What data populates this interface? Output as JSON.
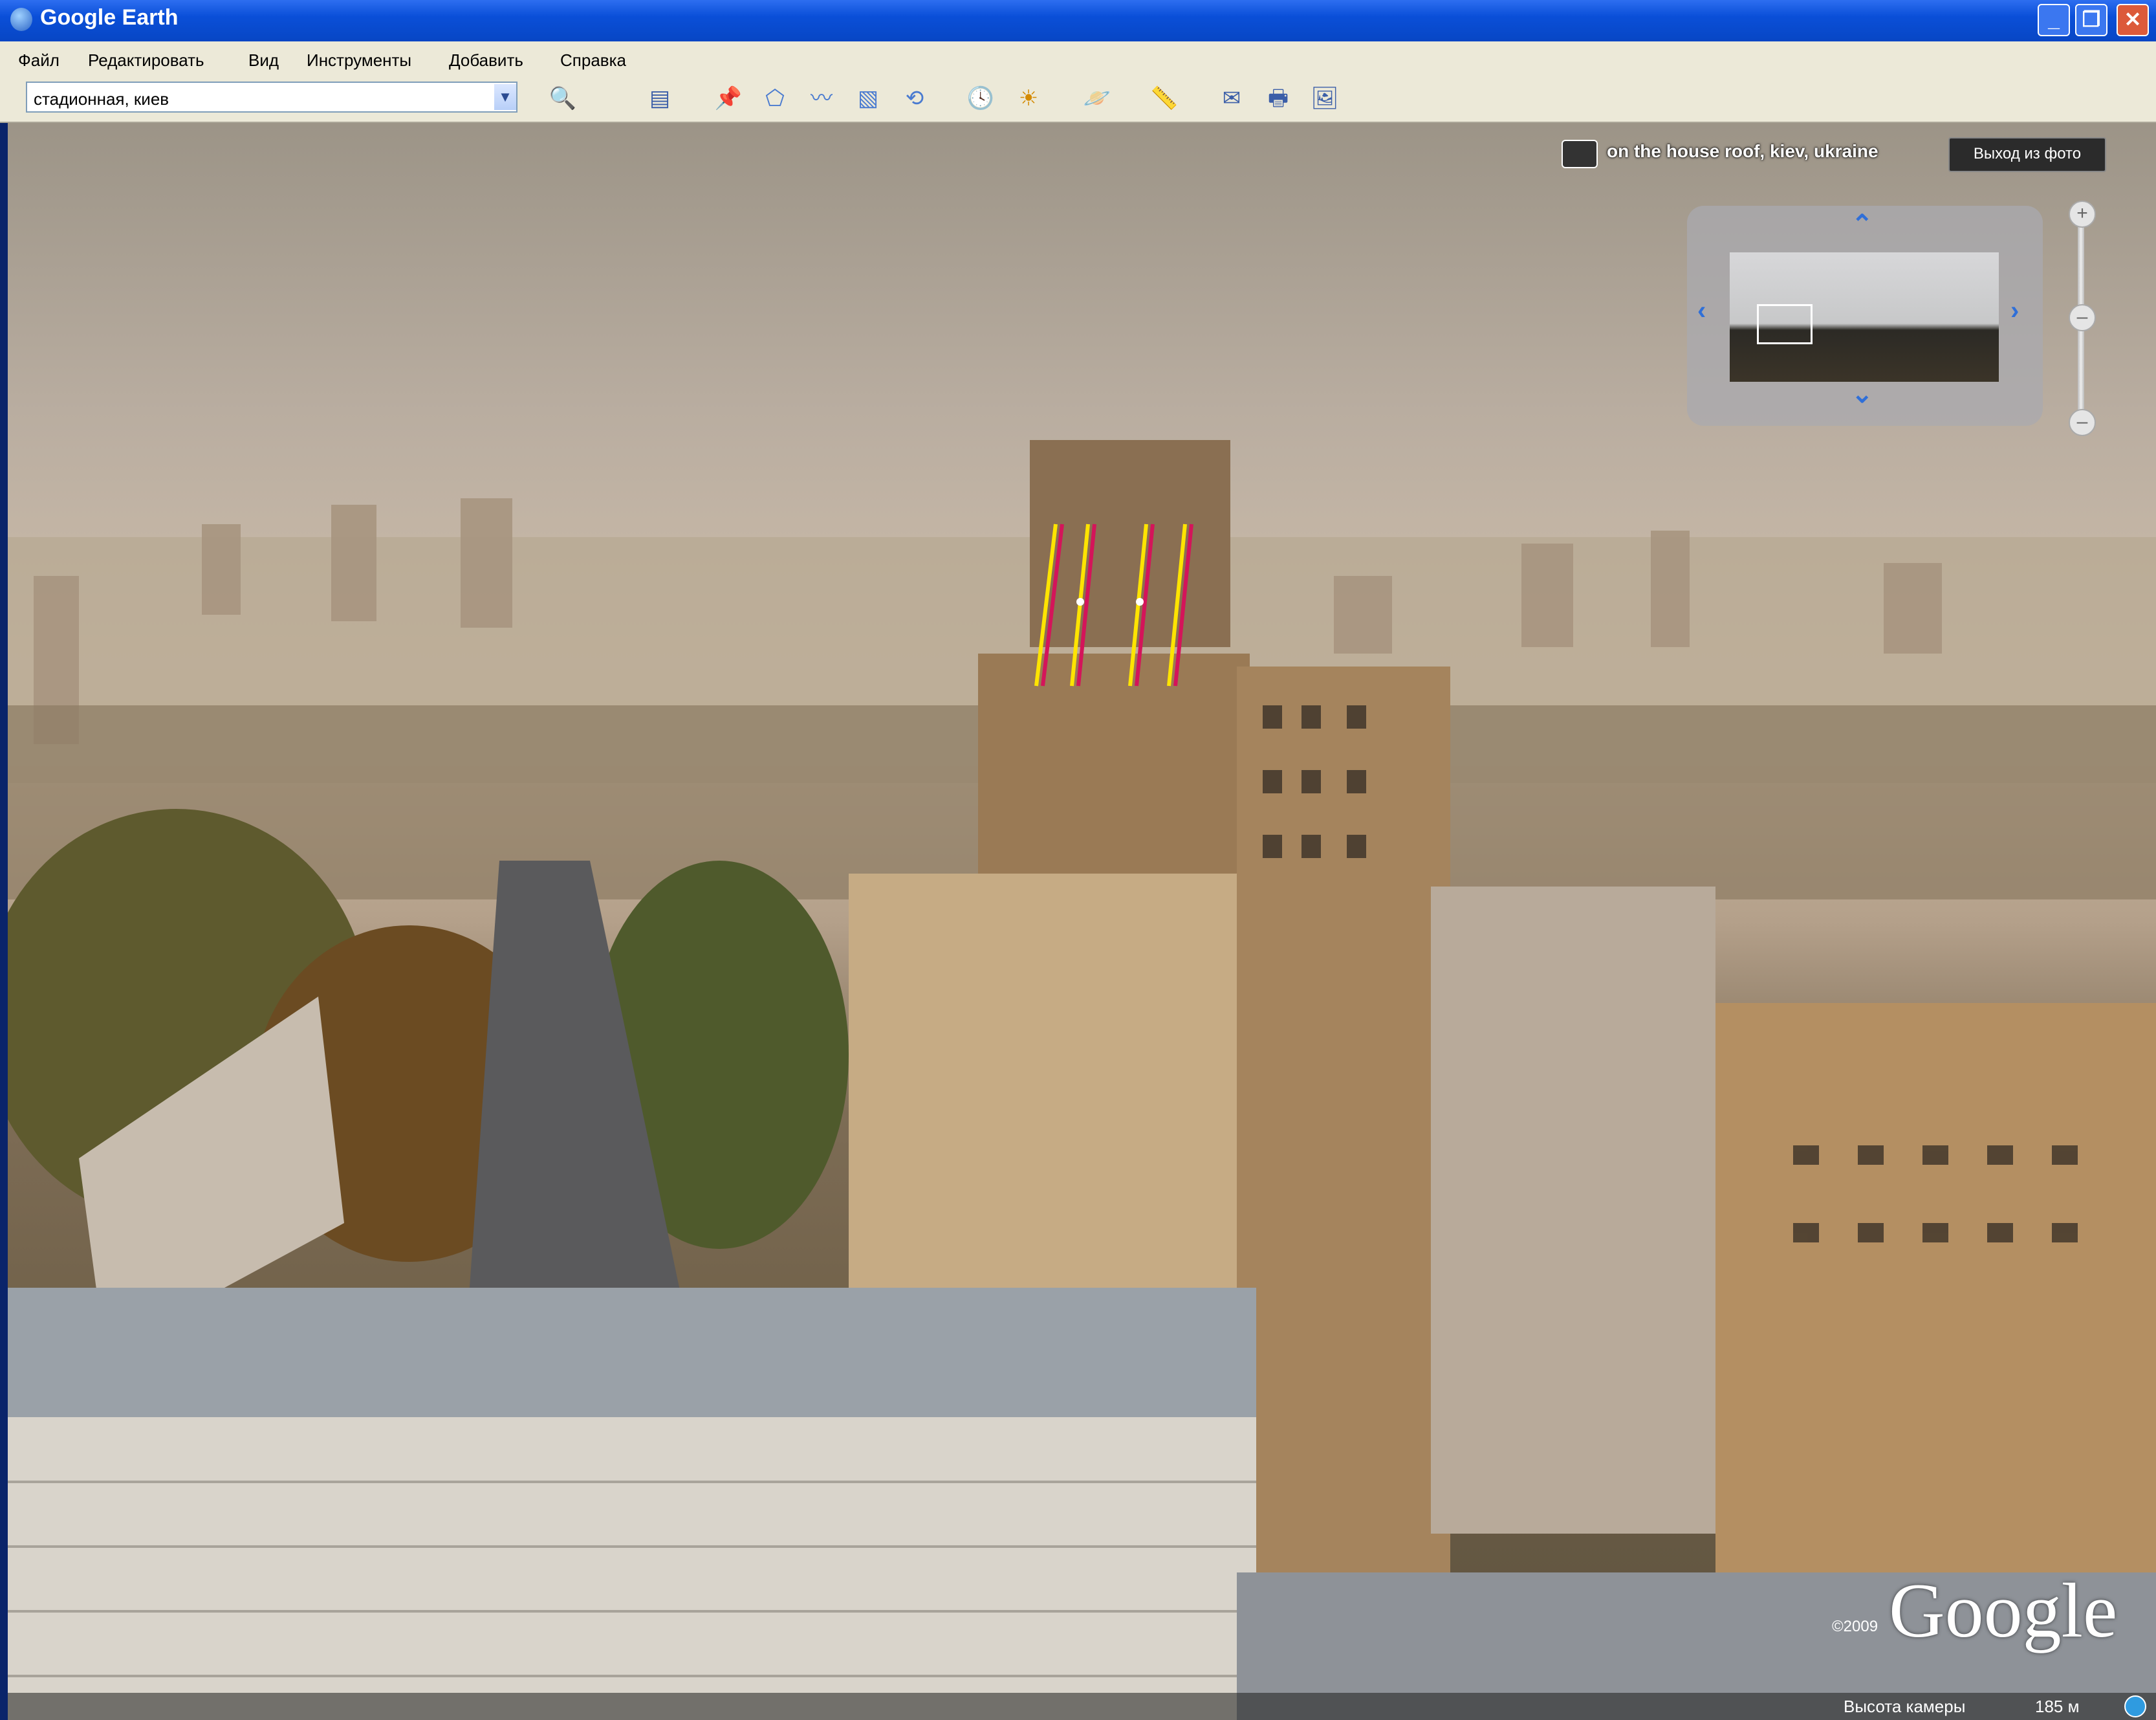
{
  "window": {
    "title": "Google Earth"
  },
  "menu": [
    "Файл",
    "Редактировать",
    "Вид",
    "Инструменты",
    "Добавить",
    "Справка"
  ],
  "search": {
    "value": "стадионная, киев"
  },
  "photo": {
    "caption": "on the house roof, kiev, ukraine",
    "exit_label": "Выход из фото"
  },
  "status": {
    "label": "Высота камеры",
    "value": "185 м"
  },
  "branding": {
    "logo": "Google",
    "copyright": "©2009"
  }
}
